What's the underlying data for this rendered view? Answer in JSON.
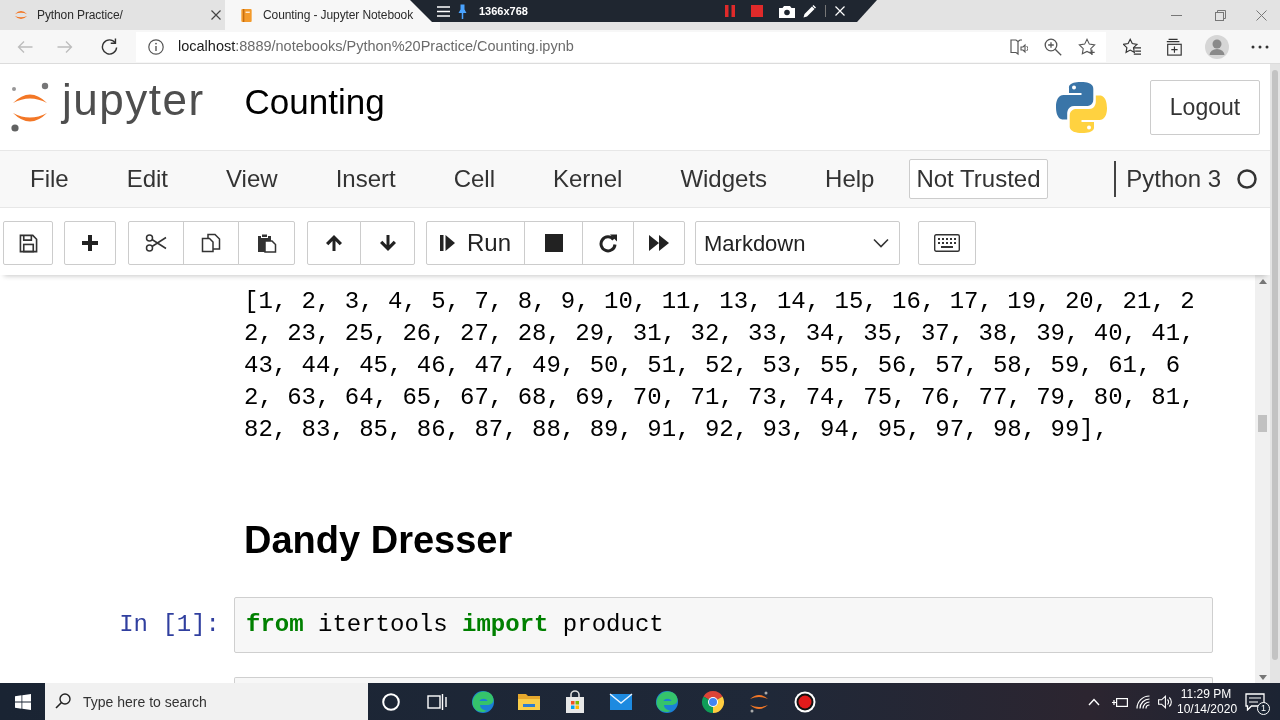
{
  "browser": {
    "tabs": [
      {
        "title": "Python Practice/",
        "selected": false
      },
      {
        "title": "Counting - Jupyter Notebook",
        "selected": true
      }
    ],
    "recorder_bar": {
      "resolution": "1366x768"
    },
    "address_bar": {
      "host": "localhost",
      "path": ":8889/notebooks/Python%20Practice/Counting.ipynb"
    }
  },
  "notebook": {
    "logo_text": "jupyter",
    "title": "Counting",
    "logout_button": "Logout",
    "menu": [
      "File",
      "Edit",
      "View",
      "Insert",
      "Cell",
      "Kernel",
      "Widgets",
      "Help"
    ],
    "trust_button": "Not Trusted",
    "kernel_name": "Python 3",
    "toolbar": {
      "run_button": "Run",
      "cell_type": "Markdown"
    },
    "cells": [
      {
        "kind": "output",
        "lines": [
          "[1, 2, 3, 4, 5, 7, 8, 9, 10, 11, 13, 14, 15, 16, 17, 19, 20, 21, 2",
          "2, 23, 25, 26, 27, 28, 29, 31, 32, 33, 34, 35, 37, 38, 39, 40, 41,",
          "43, 44, 45, 46, 47, 49, 50, 51, 52, 53, 55, 56, 57, 58, 59, 61, 6",
          "2, 63, 64, 65, 67, 68, 69, 70, 71, 73, 74, 75, 76, 77, 79, 80, 81,",
          "82, 83, 85, 86, 87, 88, 89, 91, 92, 93, 94, 95, 97, 98, 99],"
        ]
      },
      {
        "kind": "heading",
        "text": "Dandy Dresser"
      },
      {
        "kind": "code",
        "prompt": "In [1]:",
        "tokens": [
          {
            "text": "from",
            "kind": "keyword"
          },
          {
            "text": " itertools ",
            "kind": "name"
          },
          {
            "text": "import",
            "kind": "keyword"
          },
          {
            "text": " product",
            "kind": "name"
          }
        ]
      },
      {
        "kind": "code"
      }
    ]
  },
  "taskbar": {
    "search": {
      "placeholder": "Type here to search"
    },
    "time": "11:29 PM",
    "date": "10/14/2020",
    "notification_count": "1"
  }
}
